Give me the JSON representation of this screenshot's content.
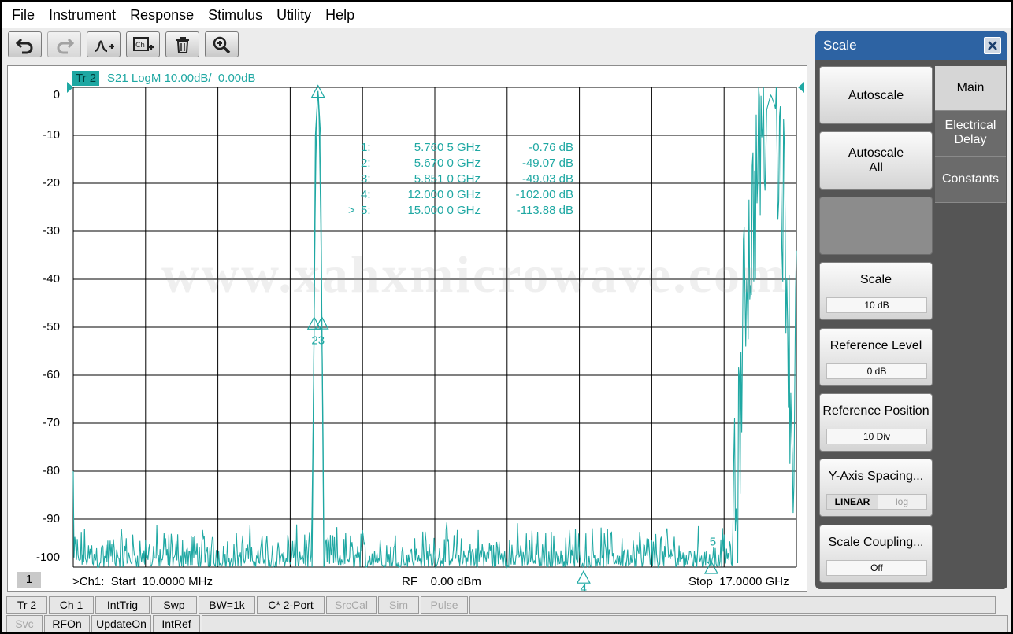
{
  "menu": [
    "File",
    "Instrument",
    "Response",
    "Stimulus",
    "Utility",
    "Help"
  ],
  "toolbar": [
    {
      "icon": "undo-icon",
      "enabled": true
    },
    {
      "icon": "redo-icon",
      "enabled": false
    },
    {
      "icon": "add-trace-icon",
      "enabled": true
    },
    {
      "icon": "add-channel-icon",
      "enabled": true
    },
    {
      "icon": "delete-icon",
      "enabled": true
    },
    {
      "icon": "zoom-icon",
      "enabled": true
    }
  ],
  "trace": {
    "tag": "Tr 2",
    "title": "S21 LogM 10.00dB/  0.00dB",
    "color": "#1fa8a3"
  },
  "y_ticks": [
    "0",
    "-10",
    "-20",
    "-30",
    "-40",
    "-50",
    "-60",
    "-70",
    "-80",
    "-90",
    "-100"
  ],
  "markers": [
    {
      "sel": "",
      "num": "1:",
      "freq": "5.760 5 GHz",
      "value": "-0.76 dB"
    },
    {
      "sel": "",
      "num": "2:",
      "freq": "5.670 0 GHz",
      "value": "-49.07 dB"
    },
    {
      "sel": "",
      "num": "3:",
      "freq": "5.851 0 GHz",
      "value": "-49.03 dB"
    },
    {
      "sel": "",
      "num": "4:",
      "freq": "12.000 0 GHz",
      "value": "-102.00 dB"
    },
    {
      "sel": ">",
      "num": "5:",
      "freq": "15.000 0 GHz",
      "value": "-113.88 dB"
    }
  ],
  "marker_labels": {
    "m23": "23",
    "m4": "4",
    "m5": "5"
  },
  "bottom": {
    "channel_number": "1",
    "start": ">Ch1:  Start  10.0000 MHz",
    "rf": "RF    0.00 dBm",
    "stop": "Stop  17.0000 GHz"
  },
  "watermark": "www.xahxmicrowave.com",
  "chart_data": {
    "type": "line",
    "ylim": [
      -100,
      0
    ],
    "xlim_ghz": [
      0.01,
      17.0
    ],
    "x_unit": "GHz",
    "y_unit": "dB",
    "grid": true,
    "series": [
      {
        "name": "S21 LogM",
        "x": [
          0.01,
          0.02,
          0.5,
          2.0,
          4.0,
          5.55,
          5.62,
          5.67,
          5.7,
          5.74,
          5.7605,
          5.78,
          5.82,
          5.851,
          5.9,
          5.98,
          7.0,
          9.0,
          12.0,
          14.0,
          15.0,
          15.3,
          15.6,
          15.8,
          16.0,
          16.2,
          16.4,
          16.5,
          16.6,
          16.75,
          16.85,
          16.95,
          17.0
        ],
        "y": [
          -80,
          -98,
          -97,
          -97,
          -97,
          -96,
          -90,
          -49.07,
          -20,
          -3,
          -0.76,
          -3,
          -25,
          -49.03,
          -90,
          -98,
          -97,
          -97,
          -102,
          -97,
          -113.88,
          -97,
          -85,
          -40,
          -25,
          -8,
          -1.5,
          -4,
          -10,
          -30,
          -60,
          -80,
          -40
        ]
      }
    ]
  },
  "panel": {
    "title": "Scale",
    "tabs": [
      "Main",
      "Electrical\nDelay",
      "Constants"
    ],
    "buttons": [
      {
        "label": "Autoscale",
        "value": null
      },
      {
        "label": "Autoscale\nAll",
        "value": null
      },
      {
        "label": "",
        "value": null
      },
      {
        "label": "Scale",
        "value": "10 dB"
      },
      {
        "label": "Reference Level",
        "value": "0 dB"
      },
      {
        "label": "Reference Position",
        "value": "10 Div"
      },
      {
        "label": "Y-Axis Spacing...",
        "value": null,
        "options": [
          "LINEAR",
          "log"
        ]
      },
      {
        "label": "Scale Coupling...",
        "value": "Off"
      }
    ]
  },
  "status1": [
    "Tr 2",
    "Ch 1",
    "IntTrig",
    "Swp",
    "BW=1k",
    "C* 2-Port",
    "SrcCal",
    "Sim",
    "Pulse"
  ],
  "status2": [
    "Svc",
    "RFOn",
    "UpdateOn",
    "IntRef"
  ]
}
